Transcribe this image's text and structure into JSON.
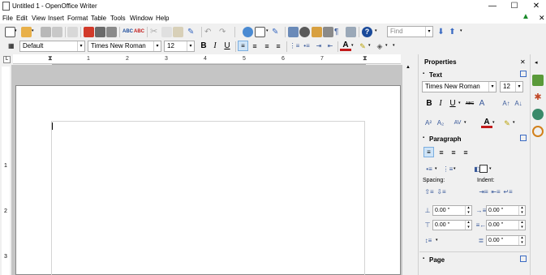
{
  "window": {
    "title": "Untitled 1 - OpenOffice Writer",
    "minimize": "—",
    "maximize": "☐",
    "close": "✕"
  },
  "menu": {
    "items": [
      "File",
      "Edit",
      "View",
      "Insert",
      "Format",
      "Table",
      "Tools",
      "Window",
      "Help"
    ]
  },
  "toolbar": {
    "find_placeholder": "Find"
  },
  "formatting": {
    "paragraph_style": "Default",
    "font_name": "Times New Roman",
    "font_size": "12",
    "bold": "B",
    "italic": "I",
    "underline": "U"
  },
  "ruler": {
    "numbers": [
      "1",
      "2",
      "3",
      "4",
      "5",
      "6",
      "7"
    ]
  },
  "vruler": {
    "numbers": [
      "1",
      "2",
      "3"
    ]
  },
  "sidebar": {
    "title": "Properties",
    "text_section": "Text",
    "font_name": "Times New Roman",
    "font_size": "12",
    "bold": "B",
    "italic": "I",
    "underline": "U",
    "strike": "ABC",
    "shadow": "A",
    "paragraph_section": "Paragraph",
    "spacing_label": "Spacing:",
    "indent_label": "Indent:",
    "spacing_above": "0.00 \"",
    "spacing_below": "0.00 \"",
    "indent_before": "0.00 \"",
    "indent_after": "0.00 \"",
    "indent_first": "0.00 \"",
    "page_section": "Page"
  }
}
